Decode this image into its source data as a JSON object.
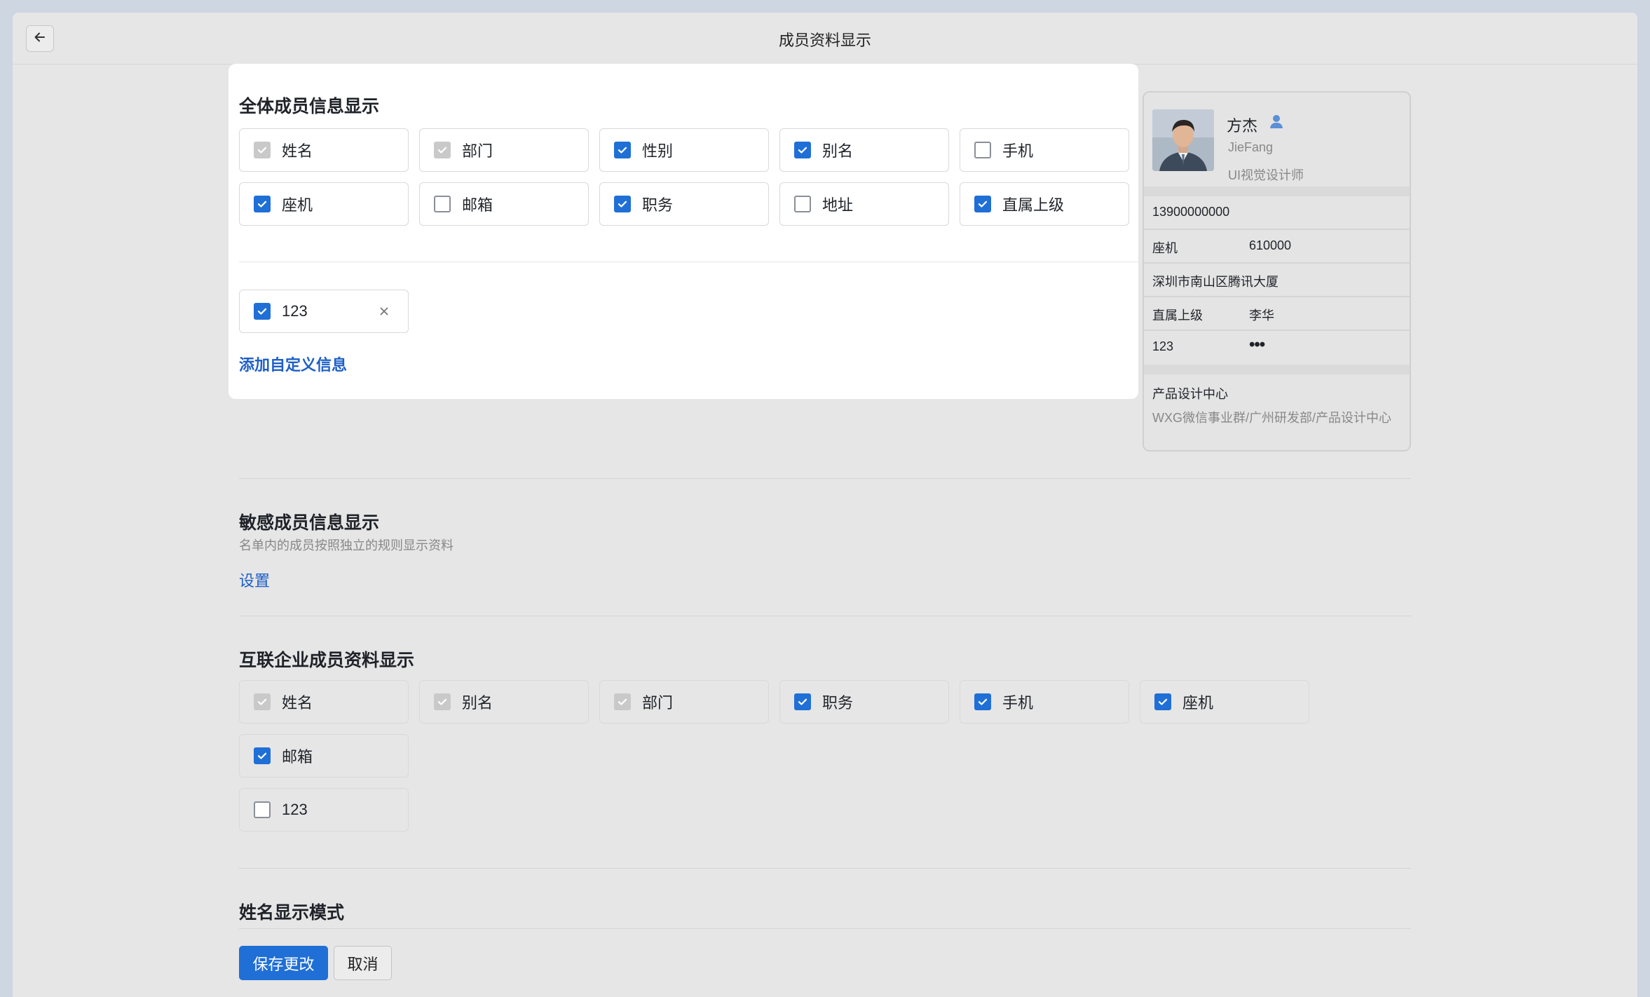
{
  "header": {
    "title": "成员资料显示"
  },
  "all_members": {
    "title": "全体成员信息显示",
    "fields": [
      {
        "label": "姓名",
        "state": "disabled"
      },
      {
        "label": "部门",
        "state": "disabled"
      },
      {
        "label": "性别",
        "state": "checked"
      },
      {
        "label": "别名",
        "state": "checked"
      },
      {
        "label": "手机",
        "state": "unchecked"
      },
      {
        "label": "座机",
        "state": "checked"
      },
      {
        "label": "邮箱",
        "state": "unchecked"
      },
      {
        "label": "职务",
        "state": "checked"
      },
      {
        "label": "地址",
        "state": "unchecked"
      },
      {
        "label": "直属上级",
        "state": "checked"
      }
    ],
    "custom_fields": [
      {
        "label": "123",
        "state": "checked"
      }
    ],
    "add_custom_link": "添加自定义信息"
  },
  "sensitive": {
    "title": "敏感成员信息显示",
    "description": "名单内的成员按照独立的规则显示资料",
    "settings_link": "设置"
  },
  "interconnected": {
    "title": "互联企业成员资料显示",
    "fields": [
      {
        "label": "姓名",
        "state": "disabled"
      },
      {
        "label": "别名",
        "state": "disabled"
      },
      {
        "label": "部门",
        "state": "disabled"
      },
      {
        "label": "职务",
        "state": "checked"
      },
      {
        "label": "手机",
        "state": "checked"
      },
      {
        "label": "座机",
        "state": "checked"
      },
      {
        "label": "邮箱",
        "state": "checked"
      },
      {
        "label": "123",
        "state": "unchecked"
      }
    ]
  },
  "name_mode": {
    "title": "姓名显示模式"
  },
  "actions": {
    "save_label": "保存更改",
    "cancel_label": "取消"
  },
  "preview": {
    "name": "方杰",
    "alias": "JieFang",
    "position": "UI视觉设计师",
    "mobile": "13900000000",
    "landline_label": "座机",
    "landline_value": "610000",
    "address": "深圳市南山区腾讯大厦",
    "manager_label": "直属上级",
    "manager_value": "李华",
    "custom_label": "123",
    "custom_value": "•••",
    "department": "产品设计中心",
    "department_path": "WXG微信事业群/广州研发部/产品设计中心"
  },
  "colors": {
    "accent": "#1f6fd6",
    "link": "#1e5fc7",
    "disabled_check": "#c9c9c9"
  }
}
